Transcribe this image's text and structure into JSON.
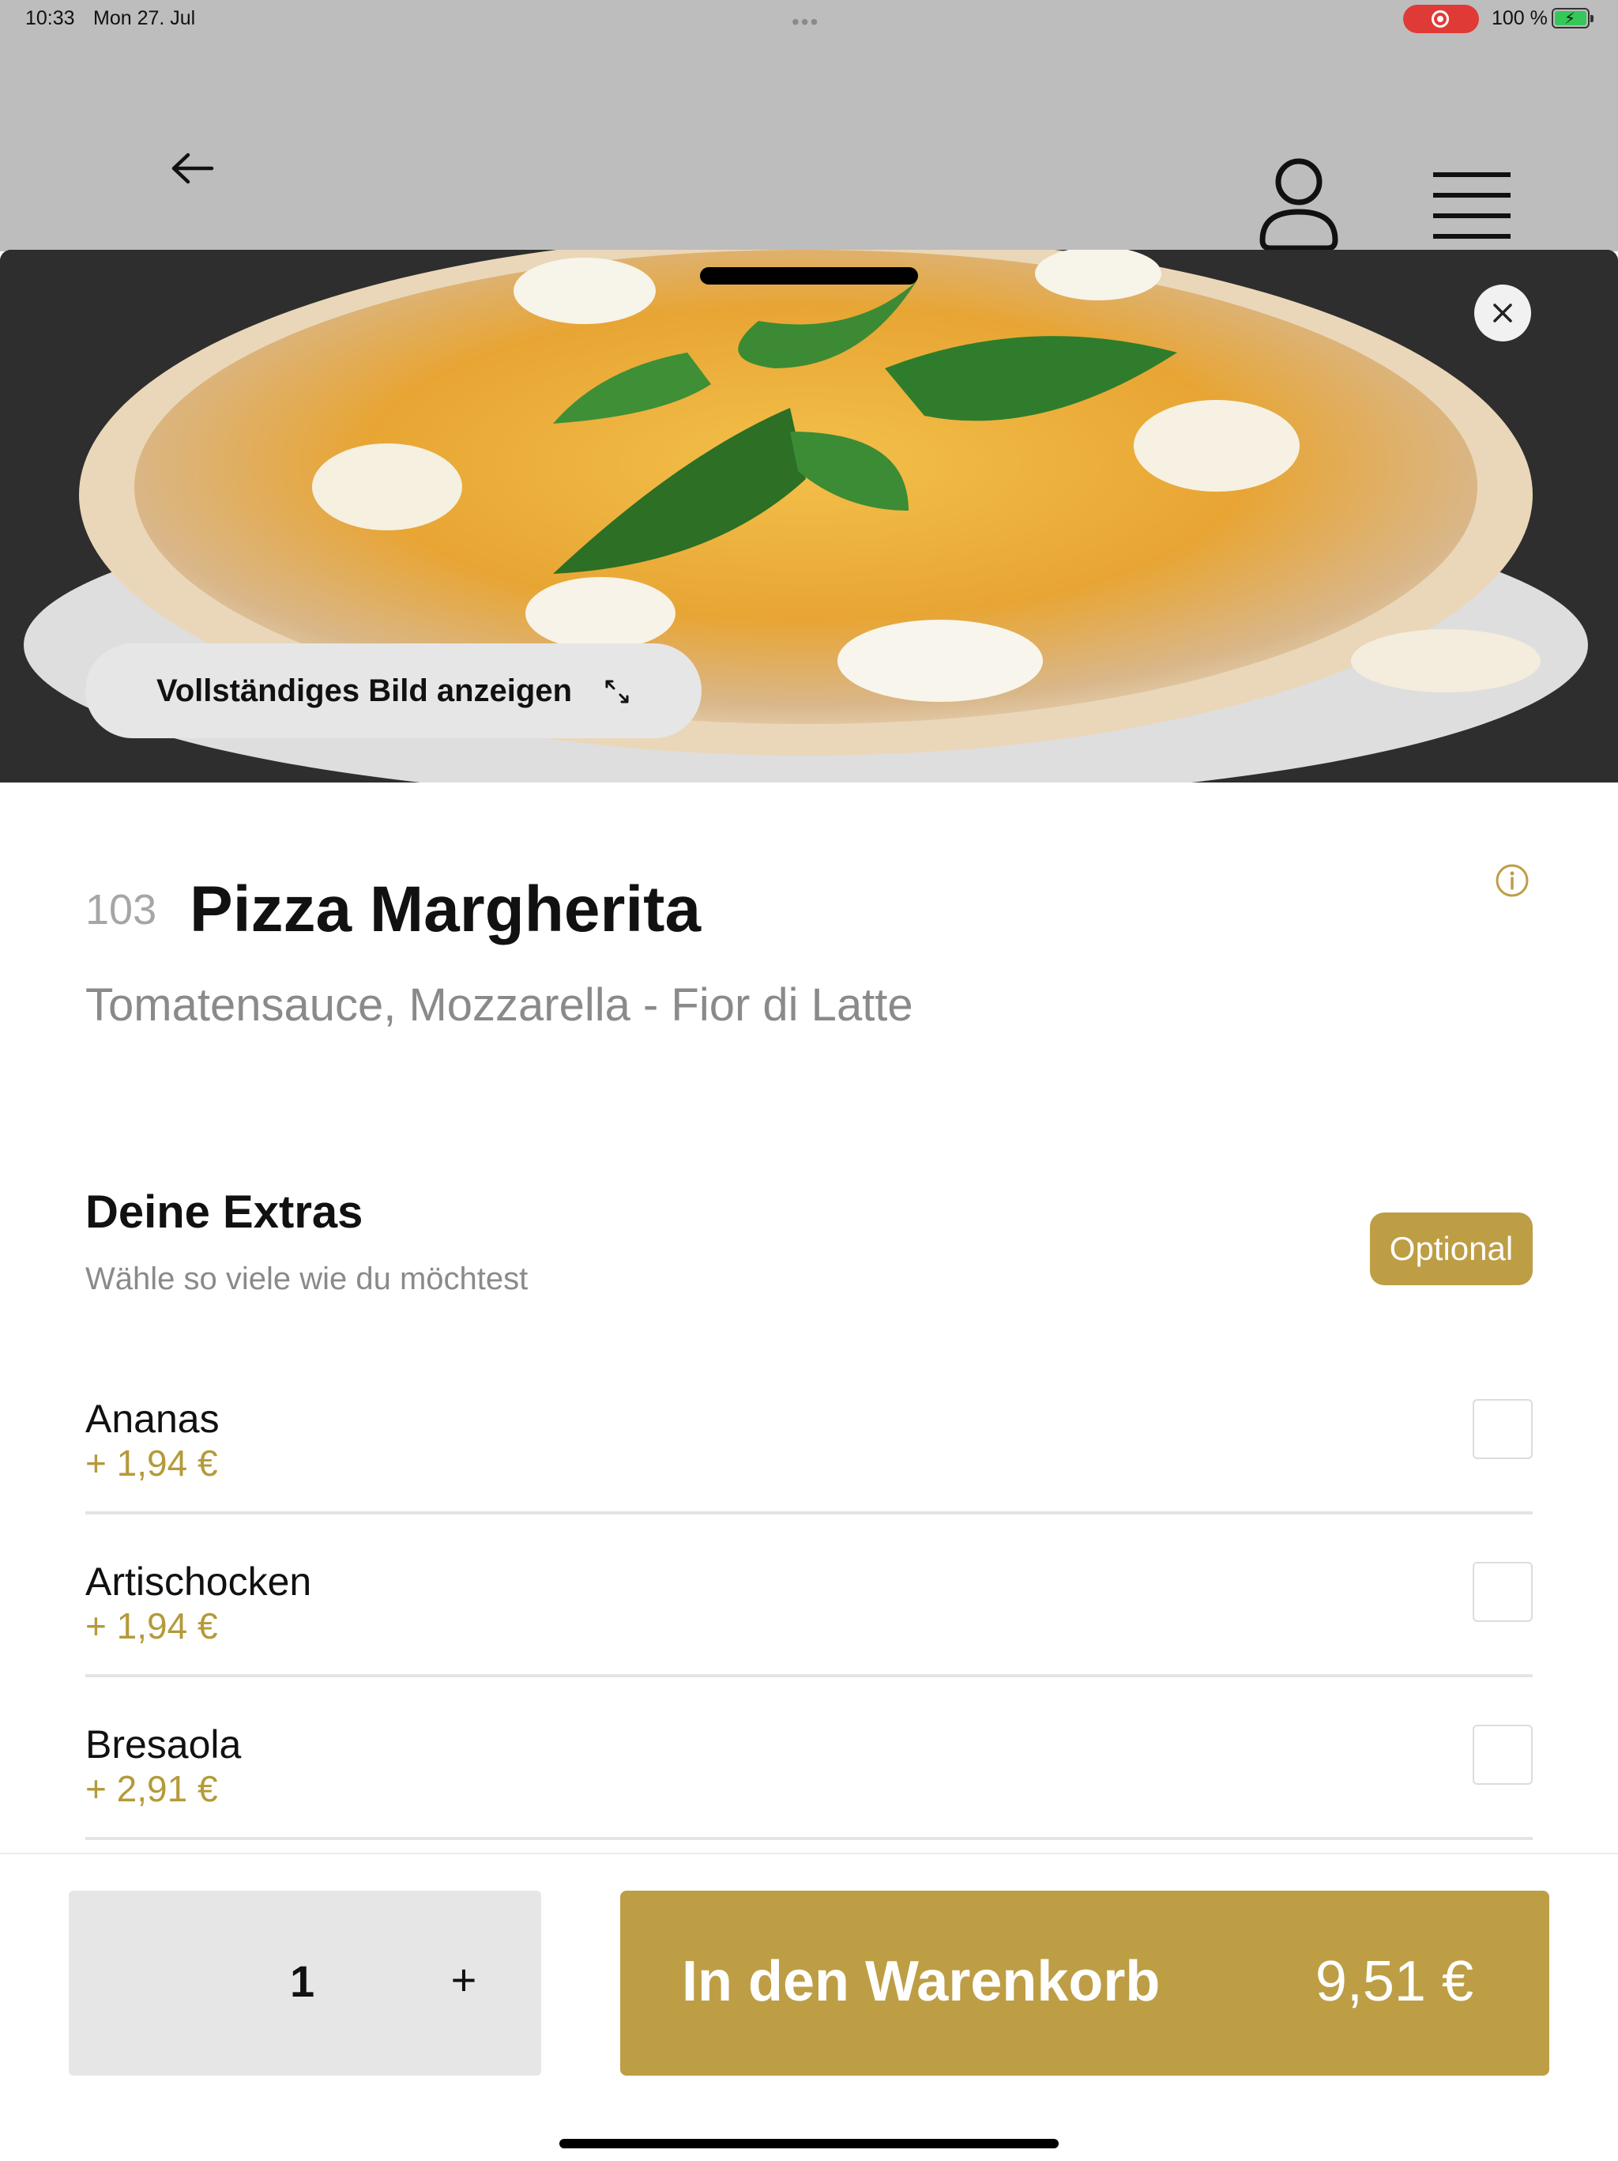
{
  "status_bar": {
    "time": "10:33",
    "date": "Mon 27. Jul",
    "multitask_indicator": "•••",
    "battery": "100 %"
  },
  "navbar": {
    "back_icon": "arrow-left-icon",
    "profile_icon": "user-icon",
    "menu_icon": "hamburger-menu-icon"
  },
  "hero": {
    "image": "pizza-margherita-photo",
    "view_full_image": "Vollständiges Bild anzeigen",
    "close_icon": "close-icon",
    "expand_icon": "expand-icon"
  },
  "product": {
    "number": "103",
    "title": "Pizza Margherita",
    "description": "Tomatensauce, Mozzarella - Fior di Latte",
    "info_icon": "info-icon"
  },
  "extras": {
    "title": "Deine Extras",
    "subtitle": "Wähle so viele wie du möchtest",
    "badge": "Optional",
    "items": [
      {
        "name": "Ananas",
        "price": "+ 1,94 €",
        "checked": false
      },
      {
        "name": "Artischocken",
        "price": "+ 1,94 €",
        "checked": false
      },
      {
        "name": "Bresaola",
        "price": "+ 2,91 €",
        "checked": false
      }
    ]
  },
  "footer": {
    "quantity": "1",
    "plus": "+",
    "add_to_cart": "In den Warenkorb",
    "total": "9,51 €"
  },
  "colors": {
    "accent": "#bd9e45",
    "price_text": "#b49a3a",
    "navbar_bg": "#bdbdbd",
    "quantity_bg": "#e6e6e6"
  }
}
